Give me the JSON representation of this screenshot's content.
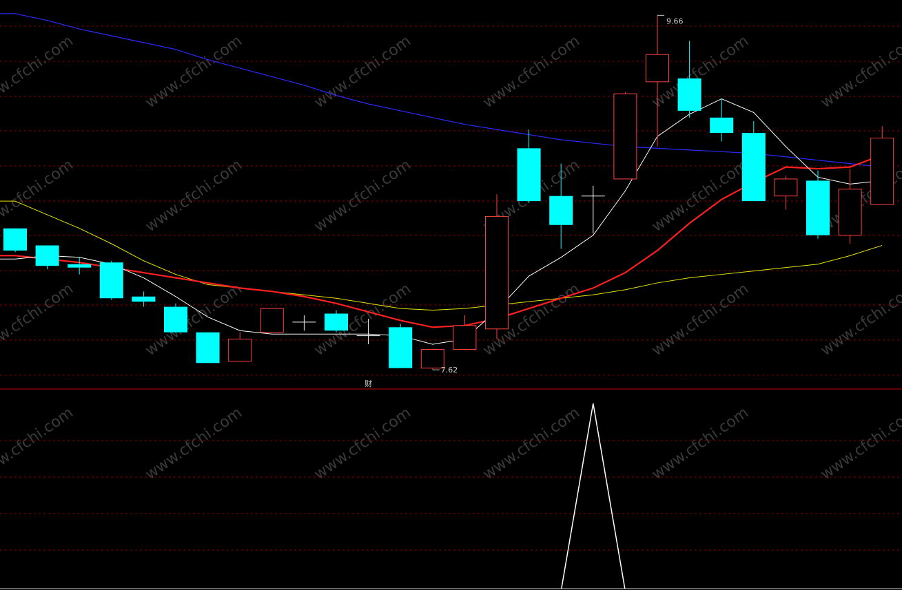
{
  "chart_data": {
    "type": "candlestick",
    "annotations": {
      "high_label": "9.66",
      "low_label": "7.62",
      "signal_label": "财"
    },
    "watermark": "www.cfchi.com",
    "colors": {
      "up": "#ff4040",
      "down": "#00ffff",
      "ma_white": "#ffffff",
      "ma_red": "#ff2020",
      "ma_yellow": "#e6e600",
      "ma_blue": "#2b2bff",
      "grid": "#8a0000",
      "divider": "#c00000"
    },
    "price_range": [
      7.5,
      9.75
    ],
    "candles": [
      {
        "o": 8.41,
        "h": 8.41,
        "l": 8.27,
        "c": 8.28
      },
      {
        "o": 8.31,
        "h": 8.31,
        "l": 8.17,
        "c": 8.19
      },
      {
        "o": 8.2,
        "h": 8.24,
        "l": 8.14,
        "c": 8.18
      },
      {
        "o": 8.21,
        "h": 8.22,
        "l": 7.99,
        "c": 8.0
      },
      {
        "o": 8.01,
        "h": 8.04,
        "l": 7.95,
        "c": 7.98
      },
      {
        "o": 7.95,
        "h": 7.97,
        "l": 7.8,
        "c": 7.8
      },
      {
        "o": 7.8,
        "h": 7.8,
        "l": 7.62,
        "c": 7.62
      },
      {
        "o": 7.63,
        "h": 7.8,
        "l": 7.63,
        "c": 7.76
      },
      {
        "o": 7.8,
        "h": 7.93,
        "l": 7.8,
        "c": 7.94
      },
      {
        "o": 7.86,
        "h": 7.9,
        "l": 7.81,
        "c": 7.86
      },
      {
        "o": 7.91,
        "h": 7.93,
        "l": 7.8,
        "c": 7.81
      },
      {
        "o": 7.78,
        "h": 7.88,
        "l": 7.73,
        "c": 7.78
      },
      {
        "o": 7.83,
        "h": 7.85,
        "l": 7.59,
        "c": 7.59
      },
      {
        "o": 7.59,
        "h": 7.7,
        "l": 7.58,
        "c": 7.7
      },
      {
        "o": 7.7,
        "h": 7.9,
        "l": 7.7,
        "c": 7.84
      },
      {
        "o": 7.82,
        "h": 8.61,
        "l": 7.76,
        "c": 8.48
      },
      {
        "o": 8.88,
        "h": 8.99,
        "l": 8.56,
        "c": 8.57
      },
      {
        "o": 8.6,
        "h": 8.79,
        "l": 8.29,
        "c": 8.43
      },
      {
        "o": 8.6,
        "h": 8.66,
        "l": 8.38,
        "c": 8.6
      },
      {
        "o": 8.7,
        "h": 9.21,
        "l": 8.7,
        "c": 9.2
      },
      {
        "o": 9.27,
        "h": 9.66,
        "l": 8.89,
        "c": 9.43
      },
      {
        "o": 9.29,
        "h": 9.51,
        "l": 9.06,
        "c": 9.1
      },
      {
        "o": 9.06,
        "h": 9.17,
        "l": 8.92,
        "c": 8.97
      },
      {
        "o": 8.97,
        "h": 9.04,
        "l": 8.59,
        "c": 8.57
      },
      {
        "o": 8.6,
        "h": 8.72,
        "l": 8.52,
        "c": 8.7
      },
      {
        "o": 8.69,
        "h": 8.75,
        "l": 8.35,
        "c": 8.37
      },
      {
        "o": 8.37,
        "h": 8.76,
        "l": 8.32,
        "c": 8.64
      },
      {
        "o": 8.55,
        "h": 9.01,
        "l": 8.55,
        "c": 8.94
      }
    ],
    "ma_white": [
      8.23,
      8.25,
      8.24,
      8.2,
      8.12,
      8.01,
      7.89,
      7.81,
      7.79,
      7.79,
      7.79,
      7.79,
      7.78,
      7.73,
      7.76,
      7.93,
      8.13,
      8.24,
      8.37,
      8.63,
      8.95,
      9.08,
      9.17,
      9.09,
      8.89,
      8.71,
      8.67,
      8.69
    ],
    "ma_red": [
      8.25,
      8.23,
      8.21,
      8.18,
      8.15,
      8.12,
      8.09,
      8.06,
      8.04,
      8.01,
      7.97,
      7.92,
      7.87,
      7.83,
      7.84,
      7.88,
      7.94,
      8.0,
      8.06,
      8.15,
      8.28,
      8.44,
      8.58,
      8.68,
      8.77,
      8.76,
      8.77,
      8.84
    ],
    "ma_yellow": [
      8.57,
      8.49,
      8.41,
      8.32,
      8.22,
      8.14,
      8.08,
      8.06,
      8.04,
      8.02,
      8.0,
      7.97,
      7.94,
      7.93,
      7.94,
      7.96,
      7.98,
      8.0,
      8.02,
      8.05,
      8.09,
      8.12,
      8.14,
      8.16,
      8.18,
      8.2,
      8.25,
      8.31
    ],
    "ma_blue": [
      9.67,
      9.63,
      9.58,
      9.54,
      9.5,
      9.46,
      9.4,
      9.35,
      9.3,
      9.25,
      9.19,
      9.14,
      9.1,
      9.06,
      9.02,
      8.99,
      8.96,
      8.93,
      8.91,
      8.89,
      8.88,
      8.87,
      8.86,
      8.85,
      8.83,
      8.81,
      8.79,
      8.77
    ],
    "signal": [
      0,
      0,
      0,
      0,
      0,
      0,
      0,
      0,
      0,
      0,
      0,
      0,
      0,
      0,
      0,
      0,
      0,
      0,
      1,
      0,
      0,
      0,
      0,
      0,
      0,
      0,
      0,
      0
    ],
    "signal_range": [
      0,
      1
    ]
  }
}
